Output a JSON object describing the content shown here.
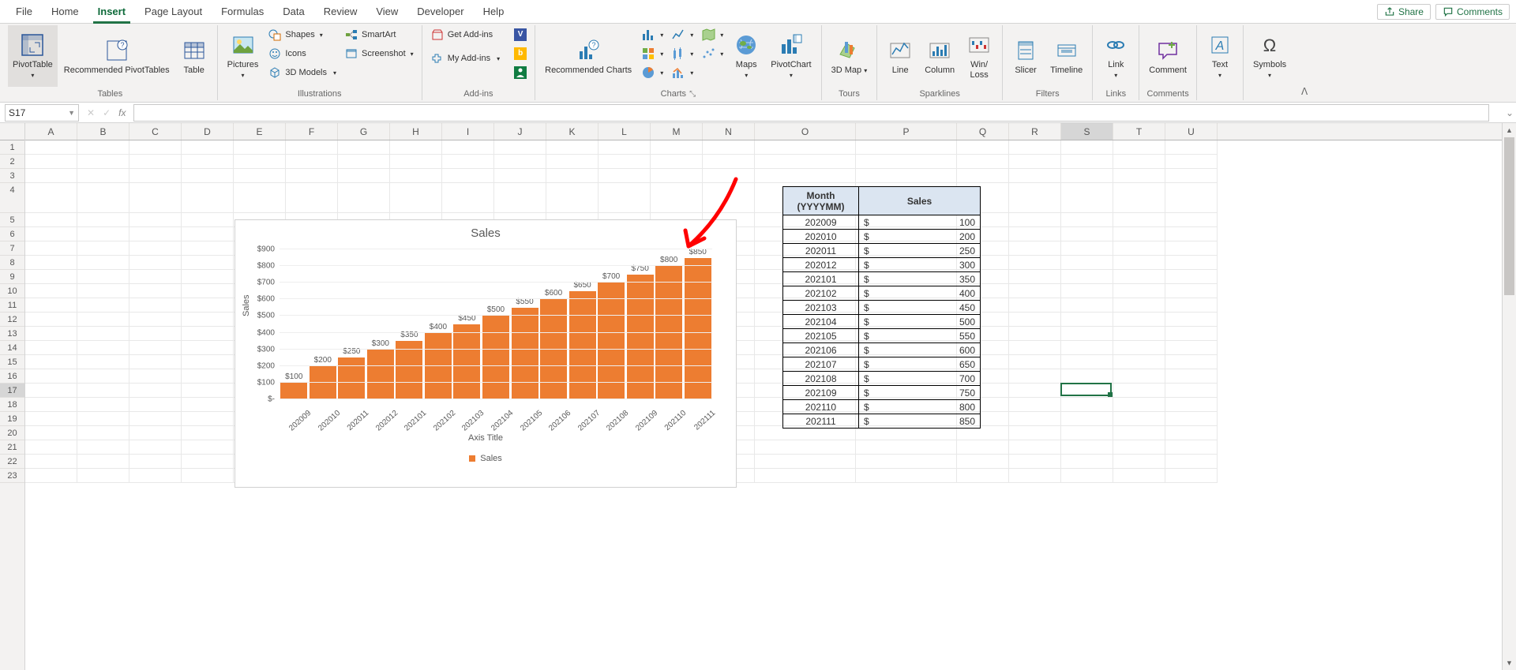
{
  "tabs": [
    "File",
    "Home",
    "Insert",
    "Page Layout",
    "Formulas",
    "Data",
    "Review",
    "View",
    "Developer",
    "Help"
  ],
  "active_tab": "Insert",
  "share": "Share",
  "comments": "Comments",
  "ribbon": {
    "tables": {
      "pivot": "PivotTable",
      "recpivot": "Recommended PivotTables",
      "table": "Table",
      "label": "Tables"
    },
    "illus": {
      "pictures": "Pictures",
      "shapes": "Shapes",
      "icons": "Icons",
      "models": "3D Models",
      "smartart": "SmartArt",
      "screenshot": "Screenshot",
      "label": "Illustrations"
    },
    "addins": {
      "get": "Get Add-ins",
      "my": "My Add-ins",
      "label": "Add-ins"
    },
    "charts": {
      "rec": "Recommended Charts",
      "maps": "Maps",
      "pivotchart": "PivotChart",
      "label": "Charts"
    },
    "tours": {
      "map": "3D Map",
      "label": "Tours"
    },
    "spark": {
      "line": "Line",
      "col": "Column",
      "wl": "Win/\nLoss",
      "label": "Sparklines"
    },
    "filters": {
      "slicer": "Slicer",
      "timeline": "Timeline",
      "label": "Filters"
    },
    "links": {
      "link": "Link",
      "label": "Links"
    },
    "cmt": {
      "comment": "Comment",
      "label": "Comments"
    },
    "text": {
      "text": "Text",
      "label": ""
    },
    "sym": {
      "sym": "Symbols",
      "label": ""
    }
  },
  "namebox": "S17",
  "columns": [
    "A",
    "B",
    "C",
    "D",
    "E",
    "F",
    "G",
    "H",
    "I",
    "J",
    "K",
    "L",
    "M",
    "N",
    "O",
    "P",
    "Q",
    "R",
    "S",
    "T",
    "U"
  ],
  "wide_columns": [
    "O",
    "P"
  ],
  "row_count": 23,
  "tall_row": 4,
  "active_row": 17,
  "active_col": "S",
  "table": {
    "hdr_month": "Month (YYYYMM)",
    "hdr_sales": "Sales",
    "rows": [
      {
        "m": "202009",
        "v": "100"
      },
      {
        "m": "202010",
        "v": "200"
      },
      {
        "m": "202011",
        "v": "250"
      },
      {
        "m": "202012",
        "v": "300"
      },
      {
        "m": "202101",
        "v": "350"
      },
      {
        "m": "202102",
        "v": "400"
      },
      {
        "m": "202103",
        "v": "450"
      },
      {
        "m": "202104",
        "v": "500"
      },
      {
        "m": "202105",
        "v": "550"
      },
      {
        "m": "202106",
        "v": "600"
      },
      {
        "m": "202107",
        "v": "650"
      },
      {
        "m": "202108",
        "v": "700"
      },
      {
        "m": "202109",
        "v": "750"
      },
      {
        "m": "202110",
        "v": "800"
      },
      {
        "m": "202111",
        "v": "850"
      }
    ],
    "sym": "$"
  },
  "chart_data": {
    "type": "bar",
    "title": "Sales",
    "ylabel": "Sales",
    "xlabel": "Axis Title",
    "legend": "Sales",
    "categories": [
      "202009",
      "202010",
      "202011",
      "202012",
      "202101",
      "202102",
      "202103",
      "202104",
      "202105",
      "202106",
      "202107",
      "202108",
      "202109",
      "202110",
      "202111"
    ],
    "values": [
      100,
      200,
      250,
      300,
      350,
      400,
      450,
      500,
      550,
      600,
      650,
      700,
      750,
      800,
      850
    ],
    "value_labels": [
      "$100",
      "$200",
      "$250",
      "$300",
      "$350",
      "$400",
      "$450",
      "$500",
      "$550",
      "$600",
      "$650",
      "$700",
      "$750",
      "$800",
      "$850"
    ],
    "yticks": [
      "$-",
      "$100",
      "$200",
      "$300",
      "$400",
      "$500",
      "$600",
      "$700",
      "$800",
      "$900"
    ],
    "ylim": [
      0,
      900
    ]
  }
}
